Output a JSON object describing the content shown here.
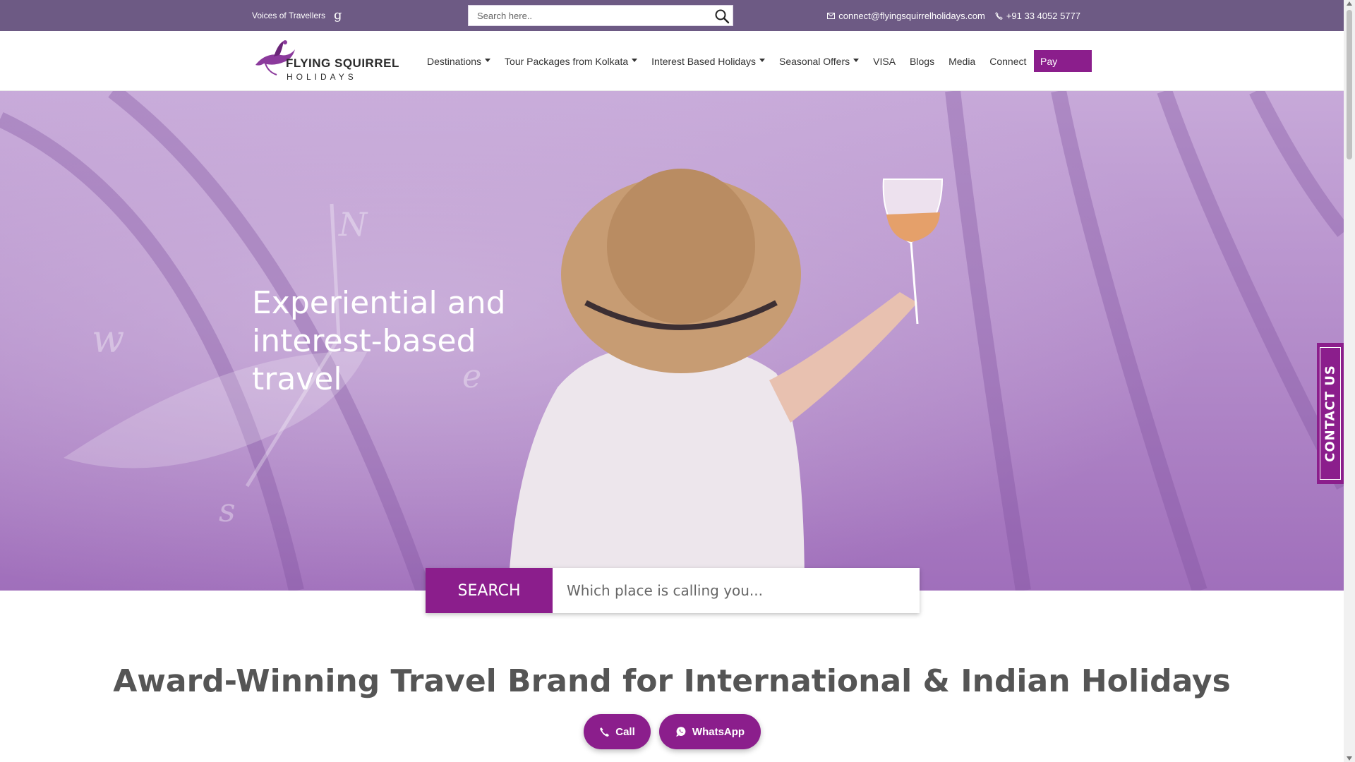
{
  "topbar": {
    "voices_label": "Voices of Travellers",
    "voices_icon": "g",
    "search_placeholder": "Search here..",
    "email": "connect@flyingsquirrelholidays.com",
    "phone": "+91 33 4052 5777"
  },
  "logo": {
    "brand": "FLYING SQUIRREL",
    "sub": "HOLIDAYS"
  },
  "nav": {
    "items": [
      {
        "label": "Destinations",
        "dropdown": true
      },
      {
        "label": "Tour Packages from Kolkata",
        "dropdown": true
      },
      {
        "label": "Interest Based Holidays",
        "dropdown": true
      },
      {
        "label": "Seasonal Offers",
        "dropdown": true
      },
      {
        "label": "VISA",
        "dropdown": false
      },
      {
        "label": "Blogs",
        "dropdown": false
      },
      {
        "label": "Media",
        "dropdown": false
      },
      {
        "label": "Connect",
        "dropdown": false
      }
    ],
    "pay_label": "Pay"
  },
  "hero": {
    "title": "Experiential and interest-based travel",
    "search_label": "SEARCH",
    "search_placeholder": "Which place is calling you..."
  },
  "contact_tab": "CONTACT US",
  "heading": "Award-Winning Travel Brand for International & Indian Holidays",
  "floating": {
    "call_label": "Call",
    "whatsapp_label": "WhatsApp"
  },
  "colors": {
    "topbar": "#6d5a84",
    "accent": "#8b1e8c",
    "hero_lavender": "#b98fce"
  }
}
